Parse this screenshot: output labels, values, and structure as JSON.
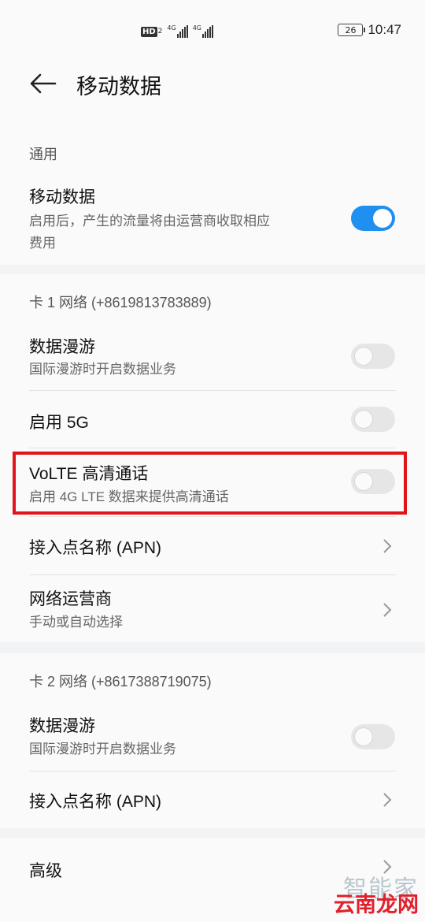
{
  "status_bar": {
    "hd_label": "HD",
    "hd_sim": "2",
    "sim1_network": "4G",
    "sim2_network": "4G",
    "battery_level": "26",
    "time": "10:47"
  },
  "header": {
    "title": "移动数据"
  },
  "general": {
    "section_label": "通用",
    "mobile_data": {
      "title": "移动数据",
      "subtitle_line1": "启用后，产生的流量将由运营商收取相应",
      "subtitle_line2": "费用",
      "enabled": true
    }
  },
  "sim1": {
    "section_label": "卡 1 网络 (+8619813783889)",
    "data_roaming": {
      "title": "数据漫游",
      "subtitle": "国际漫游时开启数据业务",
      "enabled": false
    },
    "enable_5g": {
      "title": "启用 5G",
      "enabled": false
    },
    "volte": {
      "title": "VoLTE 高清通话",
      "subtitle": "启用 4G LTE 数据来提供高清通话",
      "enabled": false
    },
    "apn": {
      "title": "接入点名称 (APN)"
    },
    "carrier": {
      "title": "网络运营商",
      "subtitle": "手动或自动选择"
    }
  },
  "sim2": {
    "section_label": "卡 2 网络 (+8617388719075)",
    "data_roaming": {
      "title": "数据漫游",
      "subtitle": "国际漫游时开启数据业务",
      "enabled": false
    },
    "apn": {
      "title": "接入点名称 (APN)"
    }
  },
  "advanced": {
    "title": "高级"
  },
  "watermark": {
    "top": "智能家",
    "bottom": "云南龙网"
  },
  "colors": {
    "accent": "#1f8ff0",
    "highlight": "#e0151b",
    "background": "#f1f3f5",
    "card": "#fafafa"
  }
}
